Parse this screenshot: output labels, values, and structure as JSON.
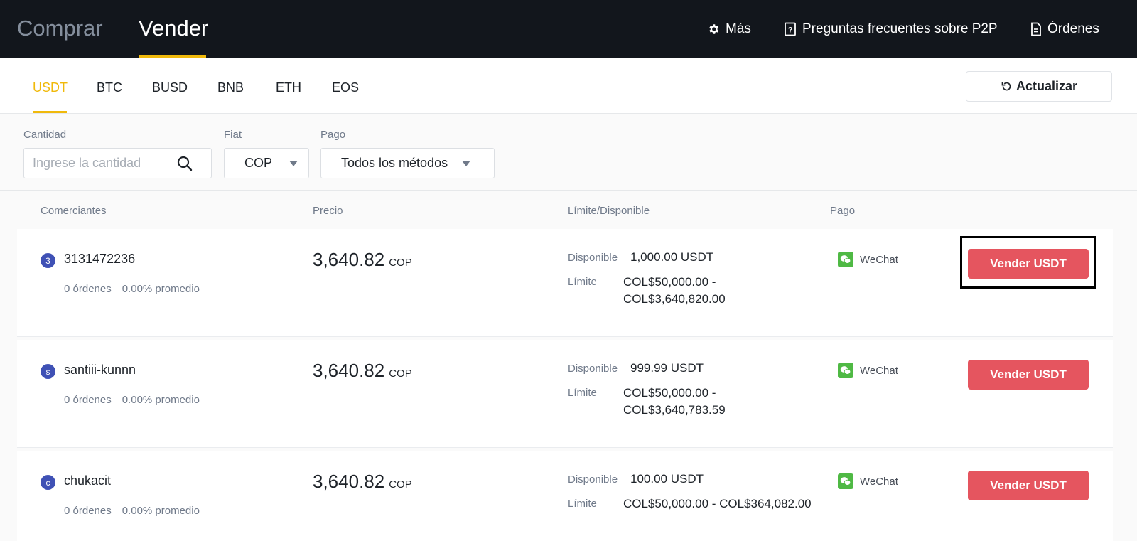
{
  "topbar": {
    "buy_tab": "Comprar",
    "sell_tab": "Vender",
    "more_label": "Más",
    "faq_label": "Preguntas frecuentes sobre P2P",
    "orders_label": "Órdenes"
  },
  "assets": {
    "tabs": [
      "USDT",
      "BTC",
      "BUSD",
      "BNB",
      "ETH",
      "EOS"
    ],
    "active": "USDT",
    "refresh_label": "Actualizar"
  },
  "filters": {
    "amount_label": "Cantidad",
    "amount_placeholder": "Ingrese la cantidad",
    "fiat_label": "Fiat",
    "fiat_value": "COP",
    "payment_label": "Pago",
    "payment_value": "Todos los métodos"
  },
  "table": {
    "headers": [
      "Comerciantes",
      "Precio",
      "Límite/Disponible",
      "Pago"
    ],
    "available_label": "Disponible",
    "limit_label": "Límite",
    "rows": [
      {
        "avatar": "3",
        "merchant": "3131472236",
        "orders": "0 órdenes",
        "completion": "0.00% promedio",
        "price": "3,640.82",
        "currency": "COP",
        "available": "1,000.00 USDT",
        "limit_line1": "COL$50,000.00 -",
        "limit_line2": "COL$3,640,820.00",
        "payment": "WeChat",
        "button": "Vender USDT"
      },
      {
        "avatar": "s",
        "merchant": "santiii-kunnn",
        "orders": "0 órdenes",
        "completion": "0.00% promedio",
        "price": "3,640.82",
        "currency": "COP",
        "available": "999.99 USDT",
        "limit_line1": "COL$50,000.00 -",
        "limit_line2": "COL$3,640,783.59",
        "payment": "WeChat",
        "button": "Vender USDT"
      },
      {
        "avatar": "c",
        "merchant": "chukacit",
        "orders": "0 órdenes",
        "completion": "0.00% promedio",
        "price": "3,640.82",
        "currency": "COP",
        "available": "100.00 USDT",
        "limit_line1": "COL$50,000.00 - COL$364,082.00",
        "limit_line2": "",
        "payment": "WeChat",
        "button": "Vender USDT"
      }
    ]
  },
  "colors": {
    "topbar_bg": "#12161c",
    "accent": "#f0b90b",
    "sell_button": "#e5555f",
    "avatar": "#3f51b5",
    "wechat": "#4fb944"
  }
}
